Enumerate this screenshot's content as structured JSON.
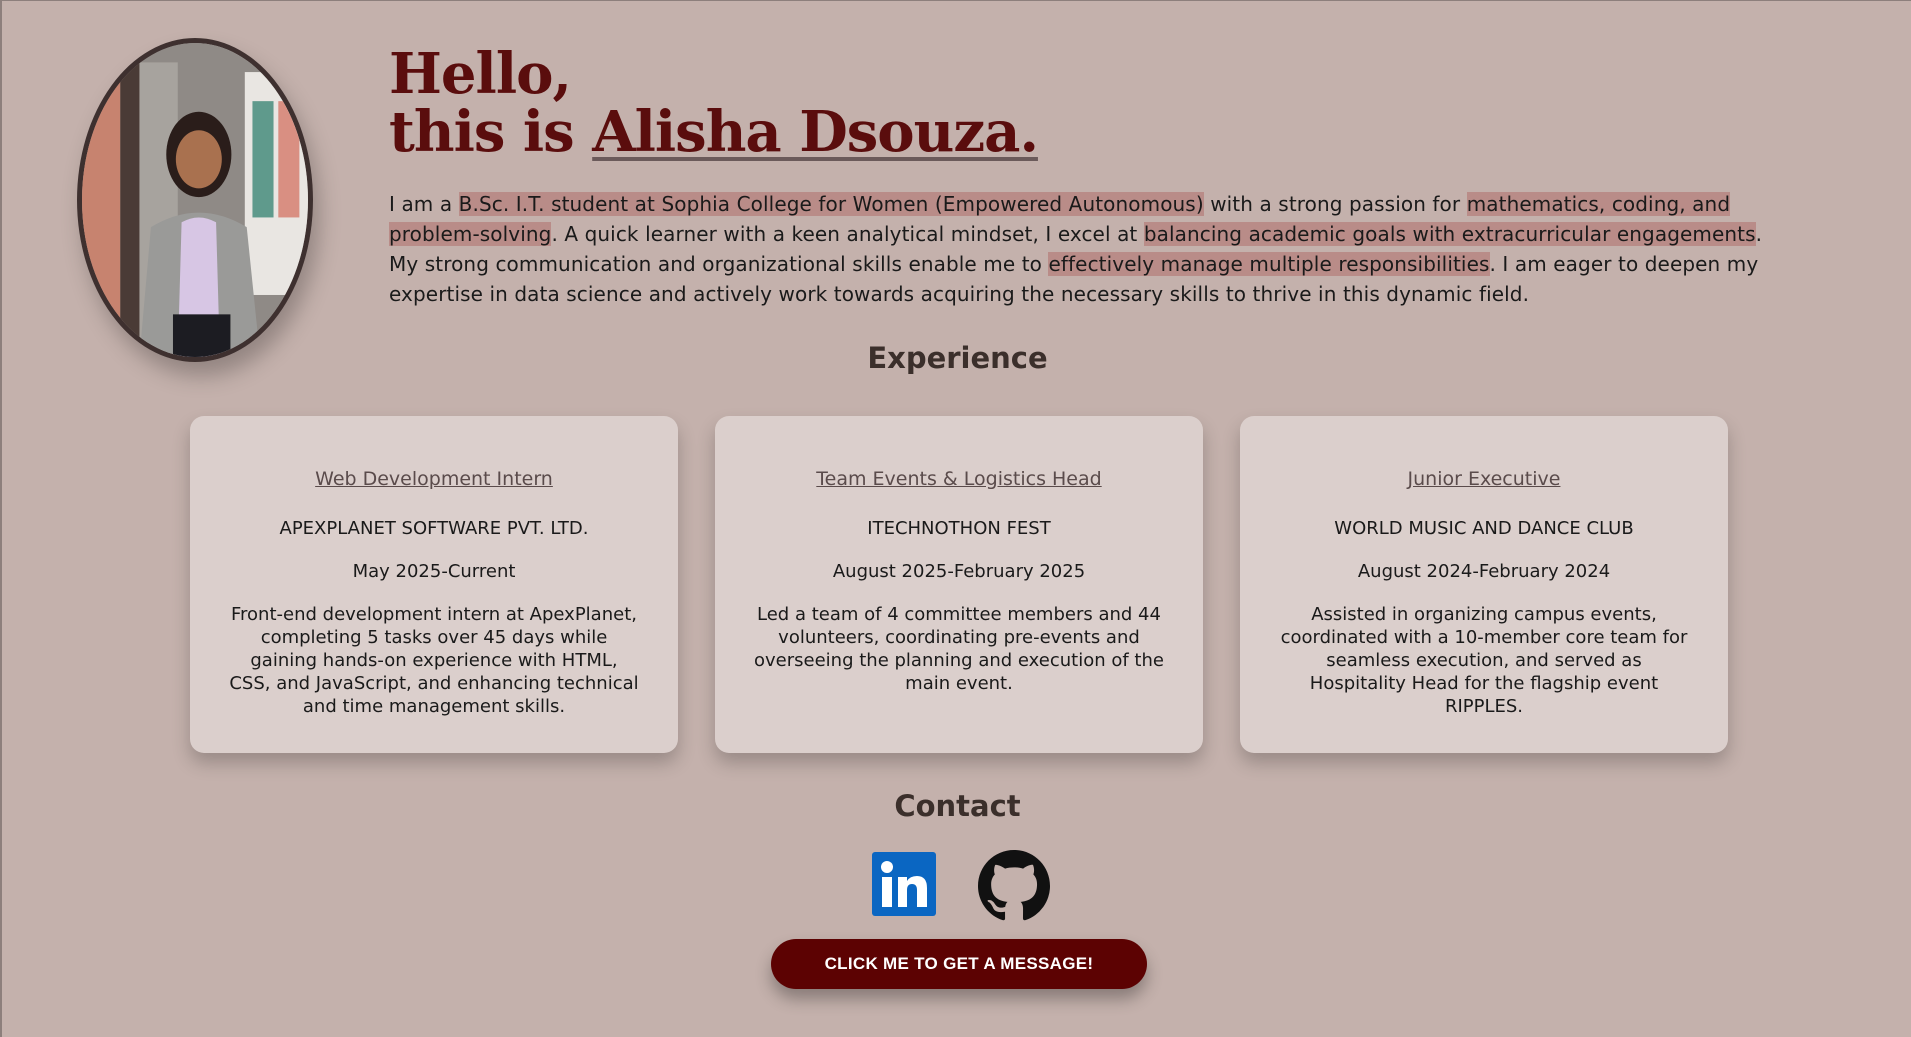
{
  "hero": {
    "greeting": "Hello,",
    "lead": "this is ",
    "name": "Alisha Dsouza.",
    "intro": [
      {
        "text": "I am a ",
        "hl": false
      },
      {
        "text": "B.Sc. I.T. student at Sophia College for Women (Empowered Autonomous)",
        "hl": true
      },
      {
        "text": " with a strong passion for ",
        "hl": false
      },
      {
        "text": "mathematics, coding, and problem-solving",
        "hl": true
      },
      {
        "text": ". A quick learner with a keen analytical mindset, I excel at ",
        "hl": false
      },
      {
        "text": "balancing academic goals with extracurricular engagements",
        "hl": true
      },
      {
        "text": ". My strong communication and organizational skills enable me to ",
        "hl": false
      },
      {
        "text": "effectively manage multiple responsibilities",
        "hl": true
      },
      {
        "text": ". I am eager to deepen my expertise in data science and actively work towards acquiring the necessary skills to thrive in this dynamic field.",
        "hl": false
      }
    ]
  },
  "experience": {
    "title": "Experience",
    "cards": [
      {
        "role": "Web Development Intern",
        "org": "APEXPLANET SOFTWARE PVT. LTD.",
        "dates": "May 2025-Current",
        "desc": "Front-end development intern at ApexPlanet, completing 5 tasks over 45 days while gaining hands-on experience with HTML, CSS, and JavaScript, and enhancing technical and time management skills."
      },
      {
        "role": "Team Events & Logistics Head",
        "org": "ITECHNOTHON FEST",
        "dates": "August 2025-February 2025",
        "desc": "Led a team of 4 committee members and 44 volunteers, coordinating pre-events and overseeing the planning and execution of the main event."
      },
      {
        "role": "Junior Executive",
        "org": "WORLD MUSIC AND DANCE CLUB",
        "dates": "August 2024-February 2024",
        "desc": "Assisted in organizing campus events, coordinated with a 10-member core team for seamless execution, and served as Hospitality Head for the flagship event RIPPLES."
      }
    ]
  },
  "contact": {
    "title": "Contact",
    "icons": [
      "linkedin-icon",
      "github-icon"
    ],
    "cta_label": "CLICK ME TO GET A MESSAGE!"
  },
  "colors": {
    "background": "#c4b1ac",
    "accent": "#5c0202",
    "card": "#dbcfcc",
    "highlight": "#b98c88",
    "linkedin": "#0a66c2"
  }
}
